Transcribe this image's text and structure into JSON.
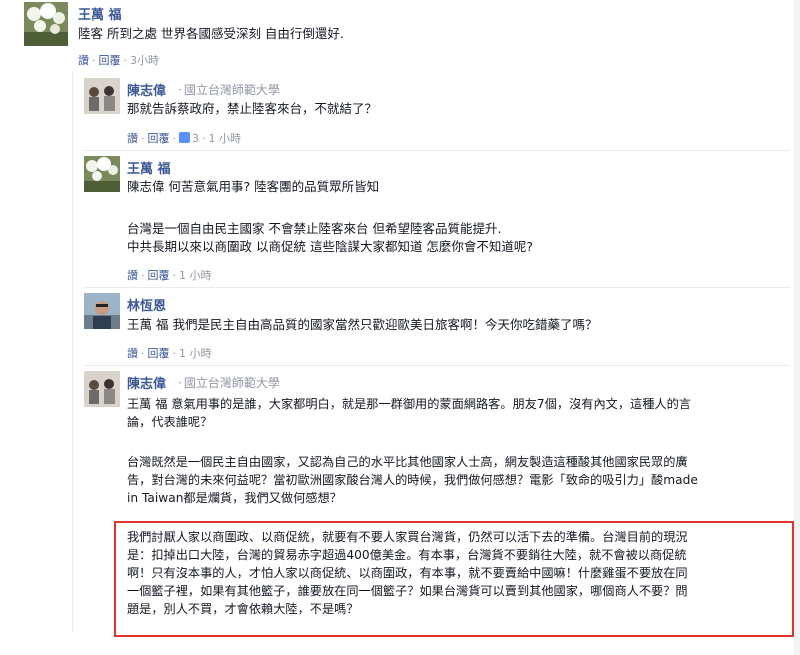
{
  "comments": [
    {
      "name": "王萬 福",
      "lines": [
        "陸客 所到之處 世界各國感受深刻 自由行倒還好."
      ],
      "actions": {
        "like": "讚",
        "reply": "回覆",
        "time": "3小時"
      }
    },
    {
      "name": "陳志偉",
      "school": "國立台灣師範大學",
      "lines": [
        "那就告訴蔡政府，禁止陸客來台，不就結了？"
      ],
      "actions": {
        "like": "讚",
        "reply": "回覆",
        "like_count": "3",
        "time": "1 小時"
      }
    },
    {
      "name": "王萬 福",
      "lines": [
        "陳志偉 何苦意氣用事? 陸客團的品質眾所皆知",
        "",
        "台灣是一個自由民主國家 不會禁止陸客來台 但希望陸客品質能提升.",
        "中共長期以來以商圍政 以商促統 這些陰謀大家都知道 怎麼你會不知道呢?"
      ],
      "actions": {
        "like": "讚",
        "reply": "回覆",
        "time": "1 小時"
      }
    },
    {
      "name": "林恆恩",
      "lines": [
        "王萬 福 我們是民主自由高品質的國家當然只歡迎歐美日旅客啊！今天你吃錯藥了嗎？"
      ],
      "actions": {
        "like": "讚",
        "reply": "回覆",
        "time": "1 小時"
      }
    },
    {
      "name": "陳志偉",
      "school": "國立台灣師範大學",
      "lines": [
        "王萬 福 意氣用事的是誰，大家都明白，就是那一群御用的蒙面網路客。朋友7個，沒有內文，這種人的言",
        "論，代表誰呢？",
        "",
        "台灣既然是一個民主自由國家，又認為自己的水平比其他國家人士高，網友製造這種酸其他國家民眾的廣",
        "告，對台灣的未來何益呢？當初歐洲國家酸台灣人的時候，我們做何感想？電影「致命的吸引力」酸made",
        "in Taiwan都是爛貨，我們又做何感想？"
      ],
      "highlight_lines": [
        "我們討厭人家以商圍政、以商促統，就要有不要人家買台灣貨，仍然可以活下去的準備。台灣目前的現況",
        "是：扣掉出口大陸，台灣的貿易赤字超過400億美金。有本事，台灣貨不要銷往大陸，就不會被以商促統",
        "啊！只有沒本事的人，才怕人家以商促統、以商圍政，有本事，就不要賣給中國嘛！什麼雞蛋不要放在同",
        "一個籃子裡，如果有其他籃子，誰要放在同一個籃子？如果台灣貨可以賣到其他國家，哪個商人不要？問",
        "題是，別人不買，才會依賴大陸，不是嗎？"
      ]
    }
  ],
  "colors": {
    "link": "#3b5998",
    "meta": "#9197a3",
    "highlight_border": "#e0342c"
  }
}
